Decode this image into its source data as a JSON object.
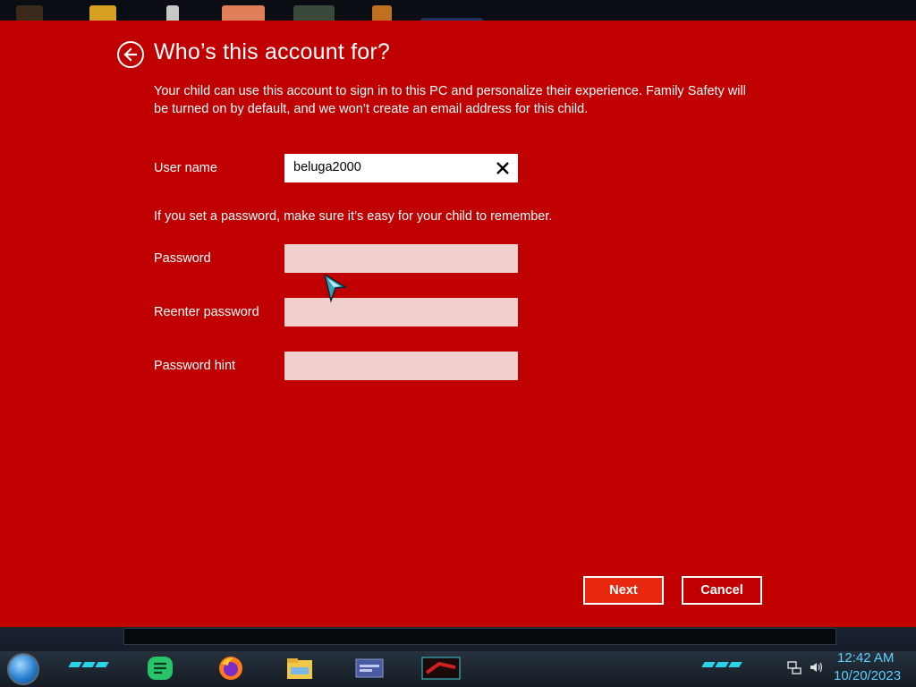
{
  "dialog": {
    "title": "Who’s this account for?",
    "description": "Your child can use this account to sign in to this PC and personalize their experience. Family Safety will be turned on by default, and we won’t create an email address for this child.",
    "username_label": "User name",
    "username_value": "beluga2000",
    "password_note": "If you set a password, make sure it’s easy for your child to remember.",
    "password_label": "Password",
    "reenter_label": "Reenter password",
    "hint_label": "Password hint",
    "next_label": "Next",
    "cancel_label": "Cancel",
    "background_color": "#c00000",
    "next_color": "#e8280f"
  },
  "taskbar": {
    "time": "12:42 AM",
    "date": "10/20/2023",
    "apps": [
      "notes-app-icon",
      "firefox-icon",
      "file-explorer-icon",
      "window-thumbnail-icon",
      "active-window-icon"
    ],
    "tray": [
      "network-icon",
      "volume-icon"
    ]
  }
}
